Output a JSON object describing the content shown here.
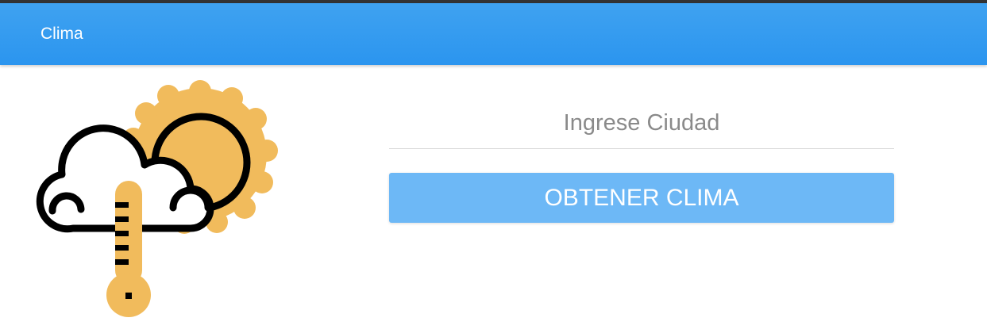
{
  "navbar": {
    "brand": "Clima",
    "color": "#2b95ef"
  },
  "illustration": {
    "icon": "weather-sun-cloud-thermometer-icon",
    "sun_color": "#f1bb5c",
    "outline_color": "#000000"
  },
  "form": {
    "city_placeholder": "Ingrese Ciudad",
    "city_value": "",
    "submit_label": "OBTENER CLIMA",
    "button_color": "#6db8f6"
  }
}
